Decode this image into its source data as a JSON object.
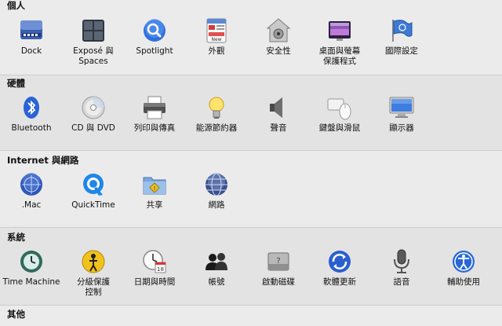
{
  "sections": [
    {
      "title": "個人",
      "items": [
        {
          "label": "Dock",
          "icon": "dock-icon"
        },
        {
          "label": "Exposé 與\nSpaces",
          "label1": "Exposé 與",
          "label2": "Spaces",
          "icon": "expose-spaces-icon"
        },
        {
          "label": "Spotlight",
          "icon": "spotlight-icon"
        },
        {
          "label": "外觀",
          "icon": "appearance-icon"
        },
        {
          "label": "安全性",
          "icon": "security-icon"
        },
        {
          "label1": "桌面與螢幕",
          "label2": "保護程式",
          "icon": "desktop-screensaver-icon"
        },
        {
          "label": "國際設定",
          "icon": "international-icon"
        }
      ]
    },
    {
      "title": "硬體",
      "items": [
        {
          "label": "Bluetooth",
          "icon": "bluetooth-icon"
        },
        {
          "label": "CD 與 DVD",
          "icon": "cd-dvd-icon"
        },
        {
          "label": "列印與傳真",
          "icon": "print-fax-icon"
        },
        {
          "label": "能源節約器",
          "icon": "energy-saver-icon"
        },
        {
          "label": "聲音",
          "icon": "sound-icon"
        },
        {
          "label": "鍵盤與滑鼠",
          "icon": "keyboard-mouse-icon"
        },
        {
          "label": "顯示器",
          "icon": "displays-icon"
        }
      ]
    },
    {
      "title": "Internet 與網路",
      "items": [
        {
          "label": ".Mac",
          "icon": "mac-icon"
        },
        {
          "label": "QuickTime",
          "icon": "quicktime-icon"
        },
        {
          "label": "共享",
          "icon": "sharing-icon"
        },
        {
          "label": "網路",
          "icon": "network-icon"
        }
      ]
    },
    {
      "title": "系統",
      "items": [
        {
          "label": "Time Machine",
          "icon": "time-machine-icon"
        },
        {
          "label1": "分級保護",
          "label2": "控制",
          "icon": "parental-controls-icon"
        },
        {
          "label": "日期與時間",
          "icon": "date-time-icon"
        },
        {
          "label": "帳號",
          "icon": "accounts-icon"
        },
        {
          "label": "啟動磁碟",
          "icon": "startup-disk-icon"
        },
        {
          "label": "軟體更新",
          "icon": "software-update-icon"
        },
        {
          "label": "語音",
          "icon": "speech-icon"
        },
        {
          "label": "輔助使用",
          "icon": "universal-access-icon"
        }
      ]
    },
    {
      "title": "其他",
      "items": []
    }
  ]
}
